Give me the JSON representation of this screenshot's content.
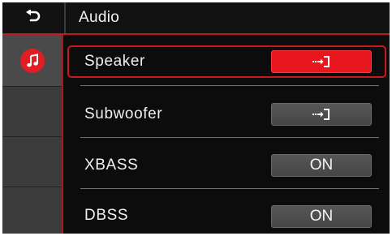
{
  "header": {
    "back_icon": "back-arrow-icon",
    "title": "Audio"
  },
  "sidebar": {
    "items": [
      {
        "icon": "music-note-icon",
        "active": true
      },
      {
        "icon": "",
        "active": false
      },
      {
        "icon": "",
        "active": false
      },
      {
        "icon": "",
        "active": false
      }
    ]
  },
  "settings": [
    {
      "label": "Speaker",
      "control": "enter",
      "control_icon": "enter-submenu-icon",
      "selected": true
    },
    {
      "label": "Subwoofer",
      "control": "enter",
      "control_icon": "enter-submenu-icon",
      "selected": false
    },
    {
      "label": "XBASS",
      "control": "toggle",
      "value": "ON",
      "selected": false
    },
    {
      "label": "DBSS",
      "control": "toggle",
      "value": "ON",
      "selected": false
    }
  ],
  "colors": {
    "accent": "#e8161d",
    "background": "#0c0c0c",
    "sidebar": "#3b3b3b"
  }
}
